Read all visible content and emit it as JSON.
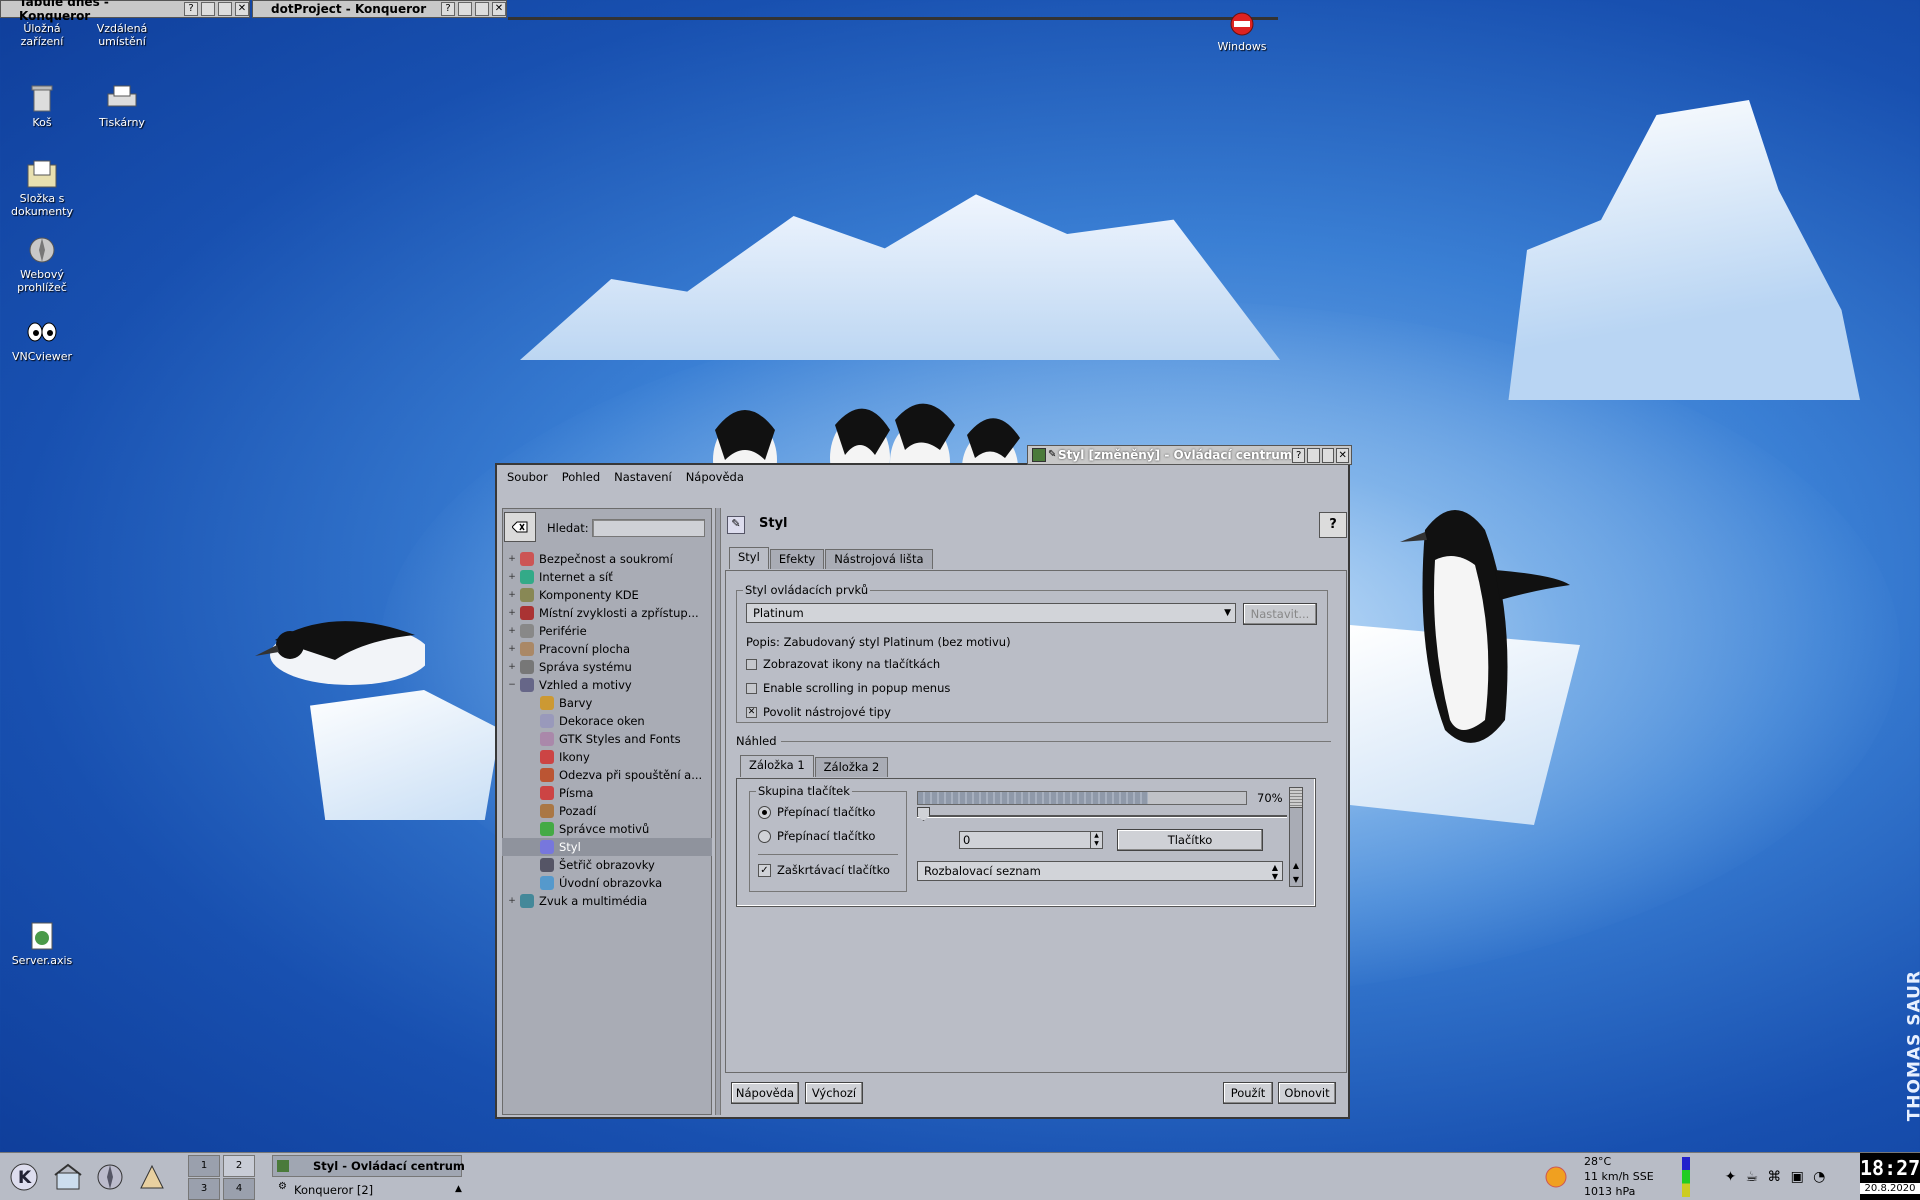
{
  "top_windows": [
    {
      "title": "Tabule dnes - Konqueror"
    },
    {
      "title": "dotProject - Konqueror"
    }
  ],
  "desktop_icons": {
    "storage": "Úložná\nzařízení",
    "remote": "Vzdálená\numístění",
    "trash": "Koš",
    "printers": "Tiskárny",
    "documents": "Složka s\ndokumenty",
    "browser": "Webový\nprohlížeč",
    "vnc": "VNCviewer",
    "server": "Server.axis",
    "windows": "Windows"
  },
  "wallpaper": {
    "credit": "THOMAS SAUR"
  },
  "window": {
    "title": "Styl [změněný] - Ovládací centrum",
    "help_glyph": "?",
    "menu": [
      "Soubor",
      "Pohled",
      "Nastavení",
      "Nápověda"
    ],
    "search_label": "Hledat:",
    "search_value": "",
    "tree": [
      {
        "label": "Bezpečnost a soukromí",
        "plus": "+"
      },
      {
        "label": "Internet a síť",
        "plus": "+"
      },
      {
        "label": "Komponenty KDE",
        "plus": "+"
      },
      {
        "label": "Místní zvyklosti a zpřístup...",
        "plus": "+"
      },
      {
        "label": "Periférie",
        "plus": "+"
      },
      {
        "label": "Pracovní plocha",
        "plus": "+"
      },
      {
        "label": "Správa systému",
        "plus": "+"
      },
      {
        "label": "Vzhled a motivy",
        "plus": "−"
      },
      {
        "label": "Barvy"
      },
      {
        "label": "Dekorace oken"
      },
      {
        "label": "GTK Styles and Fonts"
      },
      {
        "label": "Ikony"
      },
      {
        "label": "Odezva při spouštění a..."
      },
      {
        "label": "Písma"
      },
      {
        "label": "Pozadí"
      },
      {
        "label": "Správce motivů"
      },
      {
        "label": "Styl"
      },
      {
        "label": "Šetřič obrazovky"
      },
      {
        "label": "Úvodní obrazovka"
      },
      {
        "label": "Zvuk a multimédia",
        "plus": "+"
      }
    ],
    "header_title": "Styl",
    "tabs": [
      "Styl",
      "Efekty",
      "Nástrojová lišta"
    ],
    "widget_style": {
      "group_label": "Styl ovládacích prvků",
      "selected": "Platinum",
      "configure_btn": "Nastavit...",
      "description": "Popis: Zabudovaný styl Platinum (bez motivu)",
      "checks": [
        {
          "label": "Zobrazovat ikony na tlačítkách",
          "checked": false,
          "mark": ""
        },
        {
          "label": "Enable scrolling in popup menus",
          "checked": false,
          "mark": ""
        },
        {
          "label": "Povolit nástrojové tipy",
          "checked": true,
          "mark": "✕"
        }
      ]
    },
    "preview": {
      "label": "Náhled",
      "tabs": [
        "Záložka 1",
        "Záložka 2"
      ],
      "button_group": "Skupina tlačítek",
      "radios": [
        {
          "label": "Přepínací tlačítko",
          "on": true
        },
        {
          "label": "Přepínací tlačítko",
          "on": false
        }
      ],
      "checkbox": {
        "label": "Zaškrtávací tlačítko",
        "mark": "✓"
      },
      "progress_pct": 70,
      "progress_text": "70%",
      "spin_value": "0",
      "button": "Tlačítko",
      "combo": "Rozbalovací seznam"
    },
    "buttons": {
      "help": "Nápověda",
      "defaults": "Výchozí",
      "apply": "Použít",
      "reset": "Obnovit"
    }
  },
  "taskbar": {
    "pager": [
      "1",
      "2",
      "3",
      "4"
    ],
    "tasks": [
      {
        "label": "Styl - Ovládací centrum"
      },
      {
        "label": "Konqueror [2]"
      }
    ],
    "weather": {
      "temp": "28°C",
      "wind": "11 km/h SSE",
      "pressure": "1013 hPa"
    },
    "clock": "18:27",
    "date": "20.8.2020"
  }
}
